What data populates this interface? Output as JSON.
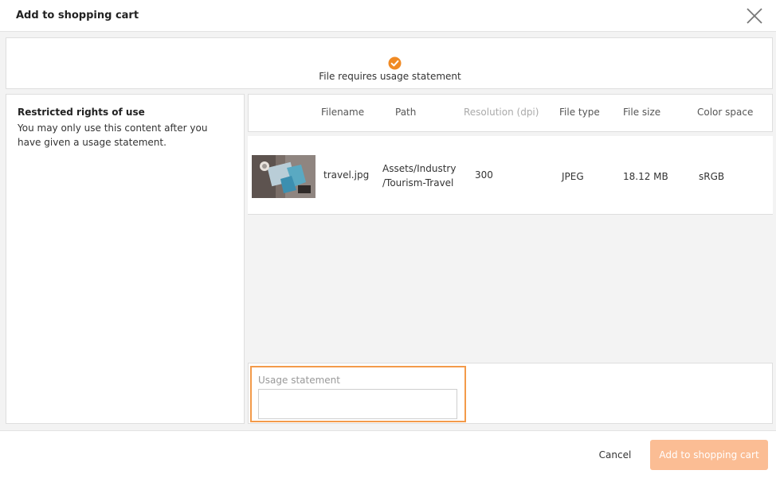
{
  "dialog": {
    "title": "Add to shopping cart",
    "close_icon": "close-icon"
  },
  "status": {
    "icon": "check-circle-icon",
    "icon_color": "#f08a24",
    "text": "File requires usage statement"
  },
  "rights": {
    "title": "Restricted rights of use",
    "description": "You may only use this content after you have given a usage statement."
  },
  "table": {
    "columns": [
      "Filename",
      "Path",
      "Resolution (dpi)",
      "File type",
      "File size",
      "Color space"
    ],
    "rows": [
      {
        "thumbnail": "travel-image-thumbnail",
        "filename": "travel.jpg",
        "path_line1": "Assets/Industry",
        "path_line2": "/Tourism-Travel",
        "resolution": "300",
        "file_type": "JPEG",
        "file_size": "18.12 MB",
        "color_space": "sRGB"
      }
    ]
  },
  "usage": {
    "label": "Usage statement",
    "value": "",
    "placeholder": "",
    "highlight_color": "#f39a4a"
  },
  "footer": {
    "cancel_label": "Cancel",
    "add_label": "Add to shopping cart",
    "add_color": "#fbbd94"
  }
}
